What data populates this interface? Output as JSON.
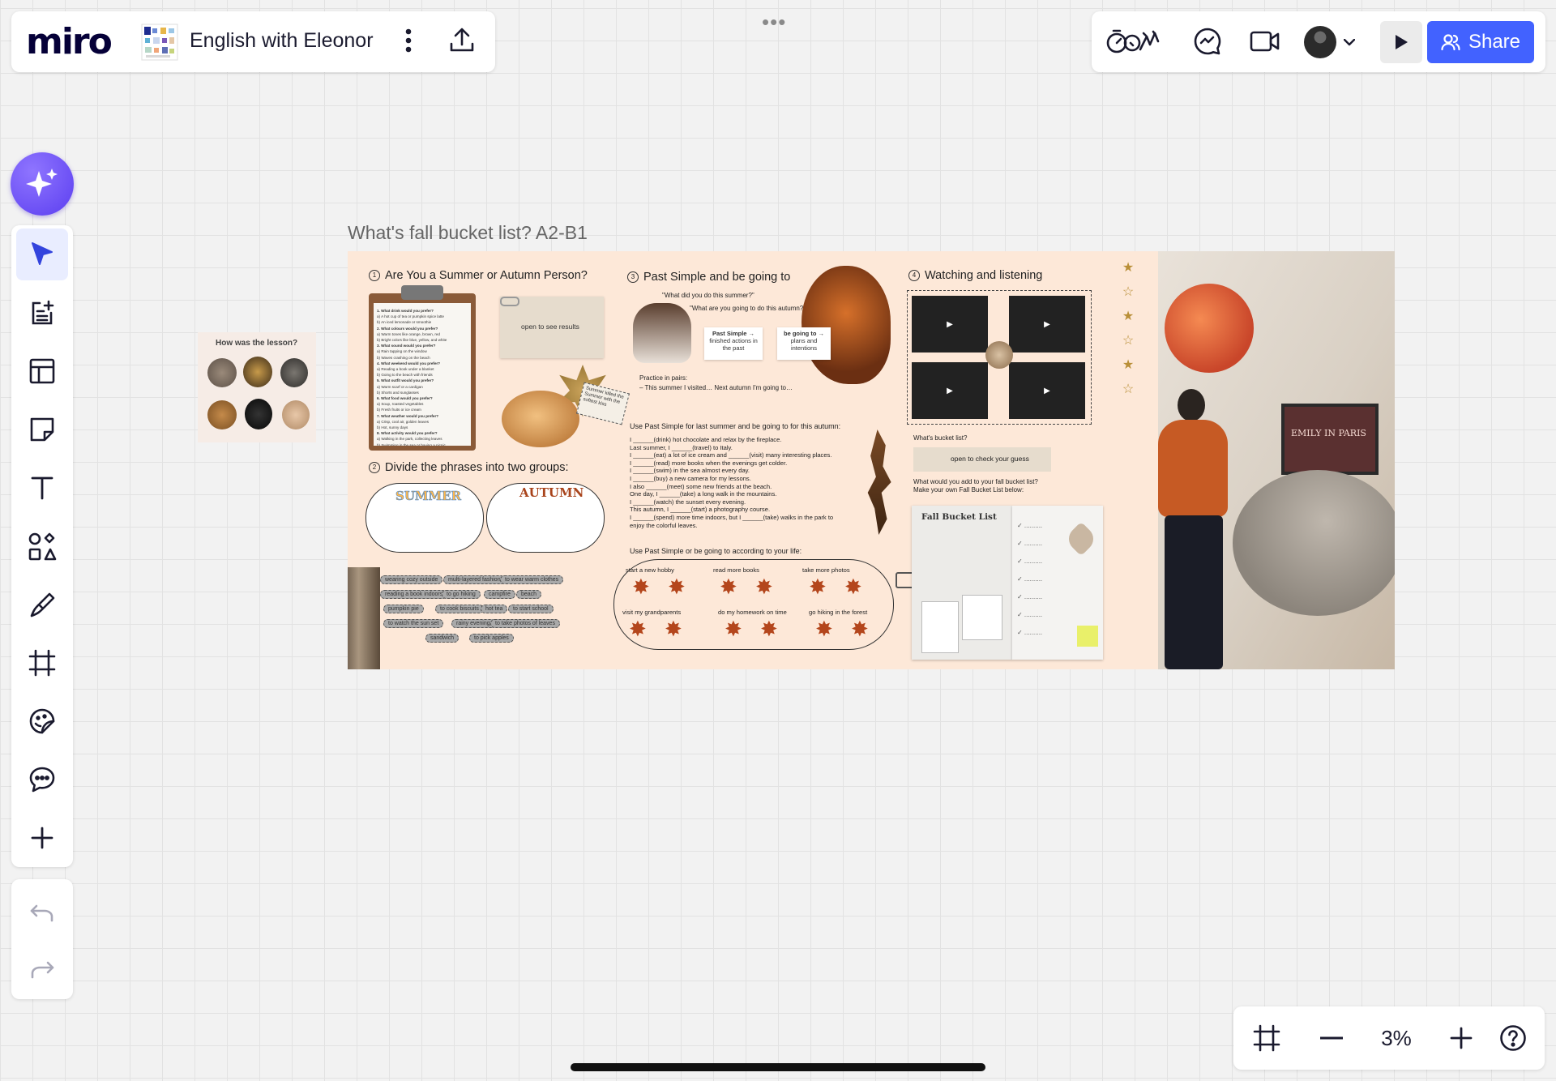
{
  "app": {
    "logo": "miro",
    "board_title": "English with Eleonor",
    "share_label": "Share",
    "zoom_level": "3%",
    "accent_color": "#4262ff",
    "ai_color": "#6a4df4"
  },
  "toolbar_icons": [
    "select-cursor-icon",
    "add-doc-icon",
    "templates-icon",
    "sticky-note-icon",
    "text-icon",
    "shapes-icon",
    "pen-icon",
    "frame-icon",
    "emoji-sticker-icon",
    "comment-icon",
    "plus-icon"
  ],
  "canvas": {
    "frame_title": "What's fall bucket list? A2-B1",
    "feedback_title": "How was the lesson?",
    "sections": {
      "s1": "Are You a Summer or Autumn Person?",
      "s2": "Divide the phrases into two groups:",
      "s3": "Past Simple and be going to",
      "s4": "Watching and listening"
    },
    "nums": {
      "n1": "1",
      "n2": "2",
      "n3": "3",
      "n4": "4"
    },
    "open_results": "open to see results",
    "summer_label": "SUMMER",
    "autumn_label": "AUTUMN",
    "quote1": "\"What did you do this summer?\"",
    "quote2": "\"What are you going to do this autumn?\"",
    "past_simple": "Past Simple →",
    "past_simple_desc": "finished actions in the past",
    "going_to": "be going to →",
    "going_to_desc": "plans and intentions",
    "practice_title": "Practice in pairs:",
    "practice_line": "– This summer I visited… Next autumn I'm going to…",
    "exercise_title": "Use Past Simple for last summer and be going to for this autumn:",
    "exercise_lines": [
      "I ______(drink) hot chocolate and relax by the fireplace.",
      "Last summer, I ______(travel) to Italy.",
      "I ______(eat) a lot of ice cream and ______(visit) many interesting places.",
      "I ______(read) more books when the evenings get colder.",
      "I ______(swim) in the sea almost every day.",
      "I ______(buy) a new camera for my lessons.",
      "I also ______(meet) some new friends at the beach.",
      "One day, I ______(take) a long walk in the mountains.",
      "I ______(watch) the sunset every evening.",
      "This autumn, I ______(start) a photography course.",
      "I ______(spend) more time indoors, but I ______(take) walks in the park to",
      "enjoy the colorful leaves."
    ],
    "life_title": "Use Past Simple or be going to according to your life:",
    "life_items": [
      "start a new hobby",
      "read more books",
      "take more photos",
      "visit my grandparents",
      "do my homework on time",
      "go hiking in the forest"
    ],
    "chips": [
      "wearing cozy outside",
      "multi-layered fashion",
      "to wear warm clothes",
      "reading a book indoors",
      "to go hiking",
      "campfire",
      "beach",
      "pumpkin pie",
      "to cook biscuits",
      "hot tea",
      "to start school",
      "to watch the sun set",
      "rainy evenings",
      "to take photos of leaves",
      "sandwich",
      "to pick apples"
    ],
    "quiz_lines": [
      "1. What drink would you prefer?",
      "a) A hot cup of tea or pumpkin spice latte",
      "b) An iced lemonade or smoothie",
      "2. What colours would you prefer?",
      "a) Warm tones like orange, brown, red",
      "b) Bright colors like blue, yellow, and white",
      "3. What sound would you prefer?",
      "a) Rain tapping on the window",
      "b) Waves crashing on the beach",
      "4. What weekend would you prefer?",
      "a) Reading a book under a blanket",
      "b) Going to the beach with friends",
      "5. What outfit would you prefer?",
      "a) Warm scarf or a cardigan",
      "b) Shorts and sunglasses",
      "6. What food would you prefer?",
      "a) Soup, roasted vegetables",
      "b) Fresh fruits or ice cream",
      "7. What weather would you prefer?",
      "a) Crisp, cool air, golden leaves",
      "b) Hot, sunny days",
      "8. What activity would you prefer?",
      "a) Walking in the park, collecting leaves",
      "b) Swimming in the sea or having a picnic"
    ],
    "bucket_q": "What's bucket list?",
    "check_guess": "open to check your guess",
    "bucket_prompt_1": "What would you add to your fall bucket list?",
    "bucket_prompt_2": "Make your own Fall Bucket List below:",
    "bucket_title": "Fall Bucket List",
    "note_text": "Summer killed the Summer with the softest kiss",
    "movie_title": "EMILY IN PARIS"
  }
}
